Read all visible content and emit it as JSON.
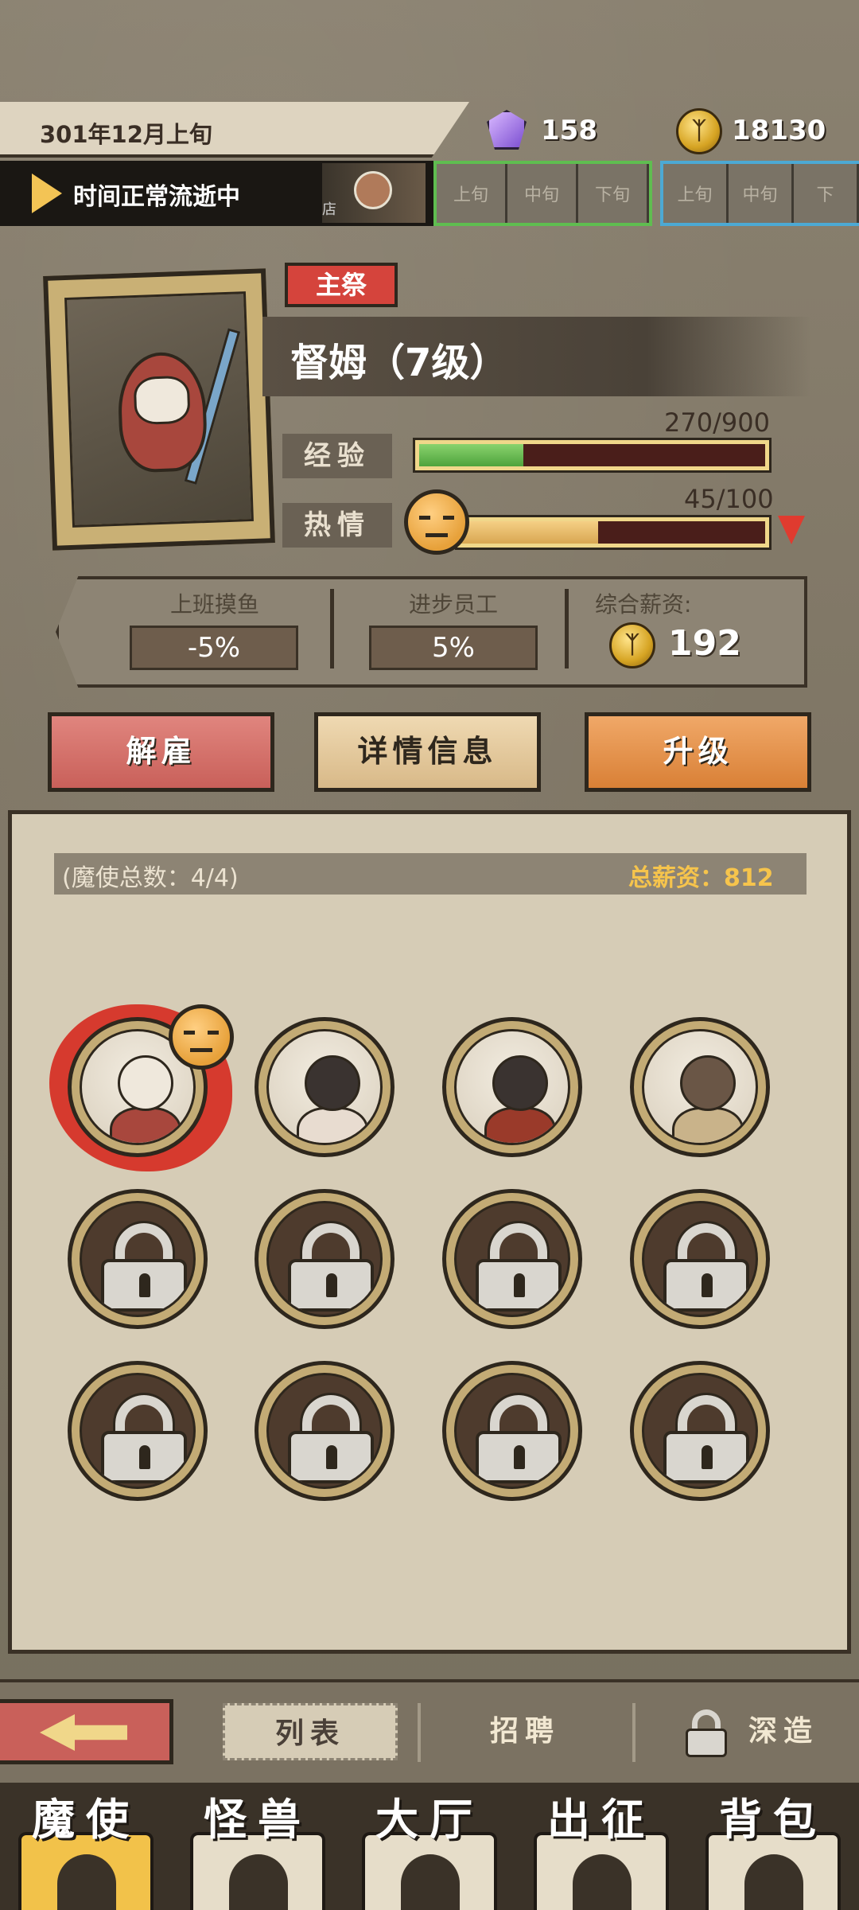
{
  "top_bar": {
    "date": "301年12月上旬",
    "crystal_count": "158",
    "coin_count": "18130",
    "time_status": "时间正常流逝中",
    "time_avatar_label": "店",
    "periods_current": [
      "上旬",
      "中旬",
      "下旬"
    ],
    "periods_next": [
      "上旬",
      "中旬",
      "下"
    ]
  },
  "character": {
    "role": "主祭",
    "name": "督姆（7级）",
    "exp_label": "经验",
    "exp_value": "270/900",
    "exp_fraction": 0.3,
    "passion_label": "热情",
    "passion_value": "45/100",
    "passion_fraction": 0.45,
    "traits": [
      {
        "title": "上班摸鱼",
        "value": "-5%"
      },
      {
        "title": "进步员工",
        "value": "5%"
      }
    ],
    "salary_title": "综合薪资:",
    "salary_value": "192"
  },
  "actions": {
    "fire": "解雇",
    "details": "详情信息",
    "upgrade": "升级"
  },
  "roster": {
    "count_text": "(魔使总数：4/4)",
    "total_salary_text": "总薪资：812"
  },
  "subnav": {
    "list": "列表",
    "recruit": "招聘",
    "forge": "深造"
  },
  "mainnav": [
    "魔使",
    "怪兽",
    "大厅",
    "出征",
    "背包"
  ],
  "colors": {
    "accent_red": "#d5443c",
    "exp_green": "#4ea33c",
    "passion_orange": "#d9a752",
    "gold": "#f6c44c"
  }
}
